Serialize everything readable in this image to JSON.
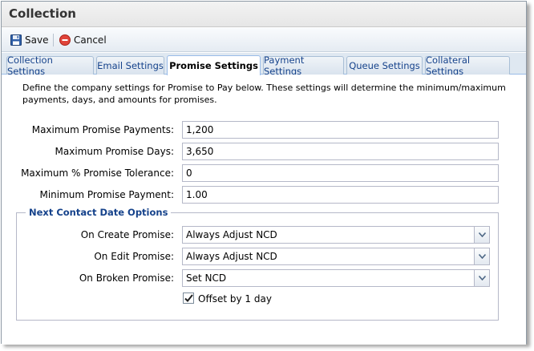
{
  "window": {
    "title": "Collection"
  },
  "toolbar": {
    "save_label": "Save",
    "cancel_label": "Cancel"
  },
  "tabs": [
    {
      "label": "Collection Settings"
    },
    {
      "label": "Email Settings"
    },
    {
      "label": "Promise Settings",
      "active": true
    },
    {
      "label": "Payment Settings"
    },
    {
      "label": "Queue Settings"
    },
    {
      "label": "Collateral Settings"
    }
  ],
  "description": "Define the company settings for Promise to Pay below. These settings will determine the minimum/maximum payments, days, and amounts for promises.",
  "fields": {
    "max_payments": {
      "label": "Maximum Promise Payments:",
      "value": "1,200"
    },
    "max_days": {
      "label": "Maximum Promise Days:",
      "value": "3,650"
    },
    "max_tolerance": {
      "label": "Maximum % Promise Tolerance:",
      "value": "0"
    },
    "min_payment": {
      "label": "Minimum Promise Payment:",
      "value": "1.00"
    }
  },
  "ncd": {
    "legend": "Next Contact Date Options",
    "on_create": {
      "label": "On Create Promise:",
      "value": "Always Adjust NCD"
    },
    "on_edit": {
      "label": "On Edit Promise:",
      "value": "Always Adjust NCD"
    },
    "on_broken": {
      "label": "On Broken Promise:",
      "value": "Set NCD"
    },
    "offset": {
      "label": "Offset by 1 day",
      "checked": true
    }
  },
  "colors": {
    "tab_text": "#15428b",
    "legend_text": "#15428b",
    "tab_border": "#99bbe8"
  }
}
